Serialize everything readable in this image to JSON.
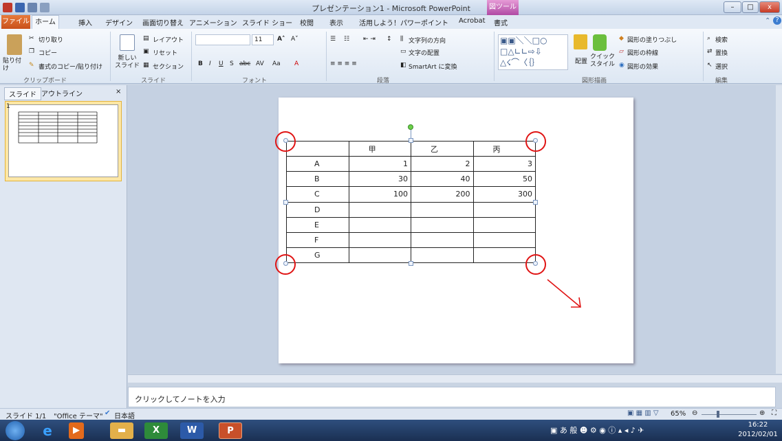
{
  "window": {
    "title": "プレゼンテーション1 - Microsoft PowerPoint",
    "context_tab": "図ツール",
    "min": "–",
    "max": "□",
    "close": "x"
  },
  "tabs": {
    "file": "ファイル",
    "home": "ホーム",
    "insert": "挿入",
    "design": "デザイン",
    "transitions": "画面切り替え",
    "animations": "アニメーション",
    "slideshow": "スライド ショー",
    "review": "校閲",
    "view": "表示",
    "ppt_addin": "活用しよう！パワーポイント",
    "acrobat": "Acrobat",
    "format": "書式"
  },
  "ribbon": {
    "paste": "貼り付け",
    "cut": "切り取り",
    "copy": "コピー",
    "format_painter": "書式のコピー/貼り付け",
    "new_slide": "新しい\nスライド",
    "layout": "レイアウト",
    "reset": "リセット",
    "section": "セクション",
    "font_size": "11",
    "text_direction": "文字列の方向",
    "align_text": "文字の配置",
    "smartart": "SmartArt に変換",
    "arrange": "配置",
    "quick_style": "クイック\nスタイル",
    "shape_fill": "図形の塗りつぶし",
    "shape_outline": "図形の枠線",
    "shape_effect": "図形の効果",
    "find": "検索",
    "replace": "置換",
    "select": "選択",
    "groups": {
      "clipboard": "クリップボード",
      "slides": "スライド",
      "font": "フォント",
      "paragraph": "段落",
      "drawing": "図形描画",
      "editing": "編集"
    }
  },
  "panel": {
    "tab_slides": "スライド",
    "tab_outline": "アウトライン",
    "close": "×",
    "slide_number": "1"
  },
  "table": {
    "headers": [
      "",
      "甲",
      "乙",
      "丙"
    ],
    "rows": [
      {
        "label": "A",
        "values": [
          "1",
          "2",
          "3"
        ]
      },
      {
        "label": "B",
        "values": [
          "30",
          "40",
          "50"
        ]
      },
      {
        "label": "C",
        "values": [
          "100",
          "200",
          "300"
        ]
      },
      {
        "label": "D",
        "values": [
          "",
          "",
          ""
        ]
      },
      {
        "label": "E",
        "values": [
          "",
          "",
          ""
        ]
      },
      {
        "label": "F",
        "values": [
          "",
          "",
          ""
        ]
      },
      {
        "label": "G",
        "values": [
          "",
          "",
          ""
        ]
      }
    ]
  },
  "notes": {
    "placeholder": "クリックしてノートを入力"
  },
  "status": {
    "slide": "スライド 1/1",
    "theme": "\"Office テーマ\"",
    "language": "日本語",
    "zoom": "65%"
  },
  "taskbar": {
    "time": "16:22",
    "date": "2012/02/01"
  },
  "colors": {
    "annotation": "#e01414",
    "file_tab": "#d05a21",
    "context_tab": "#b04aa4"
  }
}
